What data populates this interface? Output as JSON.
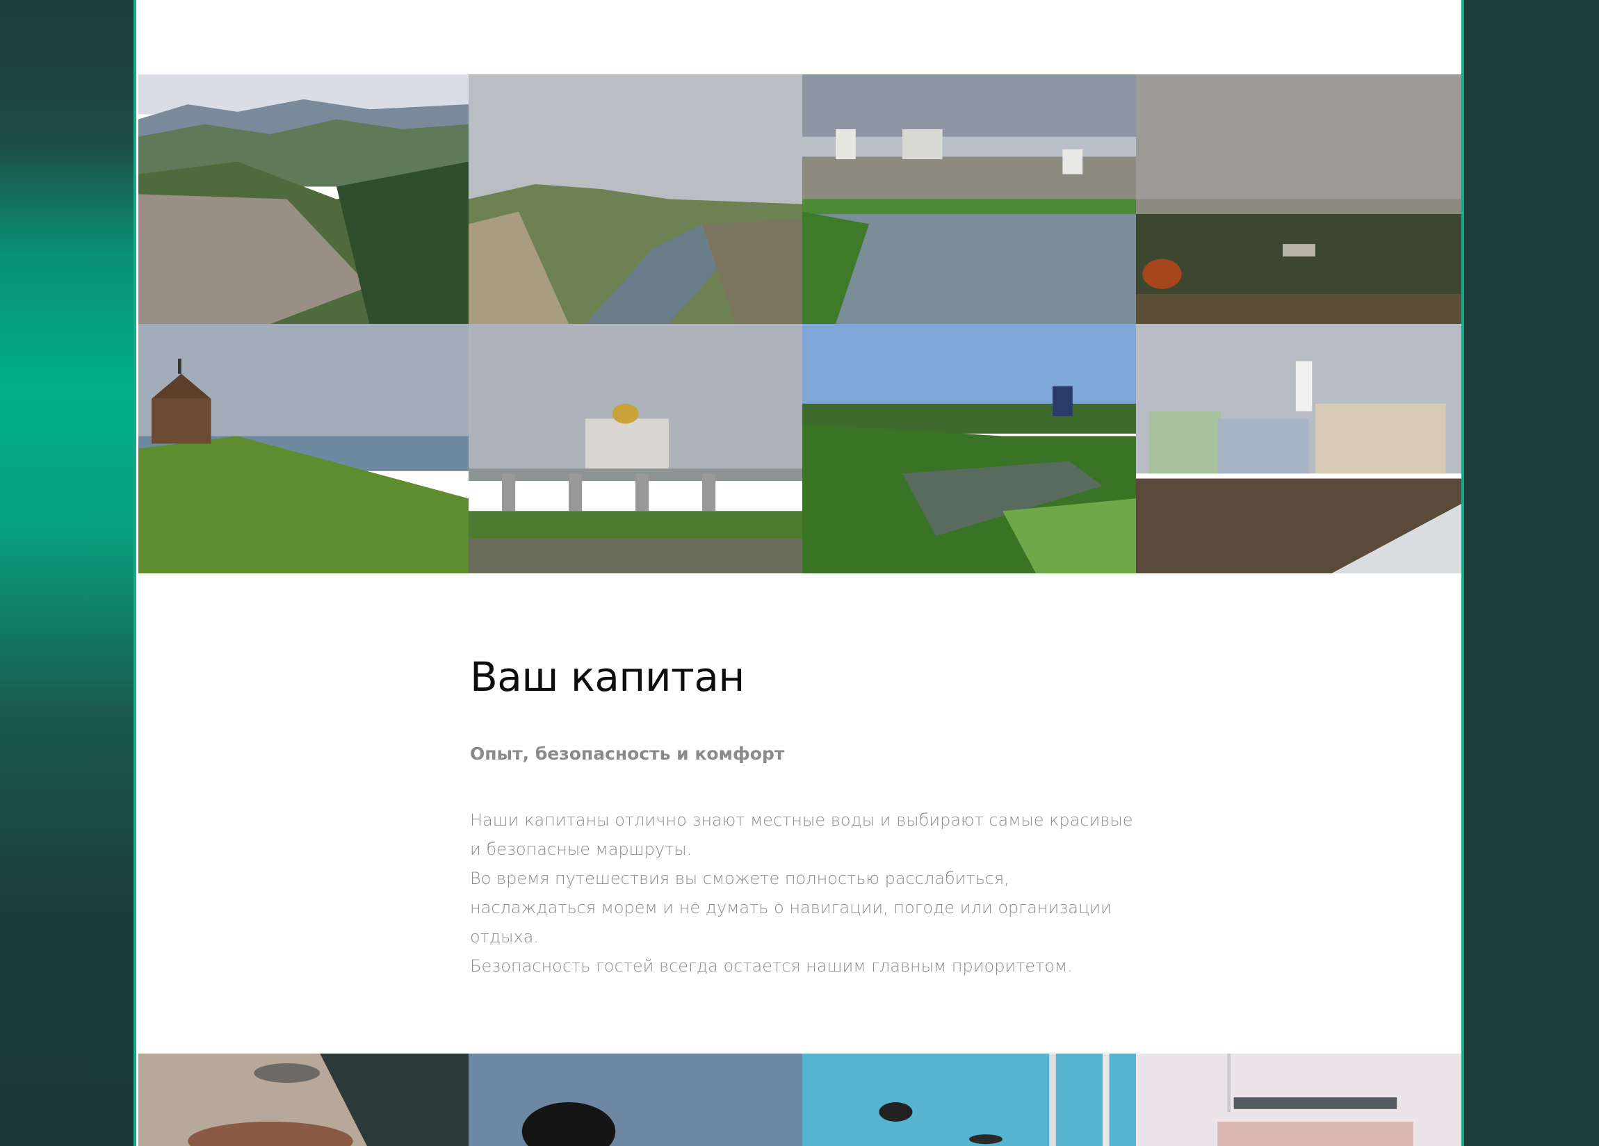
{
  "captain_section": {
    "title": "Ваш капитан",
    "subtitle": "Опыт, безопасность и комфорт",
    "paragraphs": [
      "Наши капитаны отлично знают местные воды и выбирают самые красивые и безопасные маршруты.",
      "Во время путешествия вы сможете полностью расслабиться, наслаждаться морем и не думать о навигации, погоде или организации отдыха.",
      "Безопасность гостей всегда остается нашим главным приоритетом."
    ]
  },
  "colors": {
    "accent": "#16a987",
    "side_dark": "#1e3d3a",
    "side_bright": "#00b085"
  },
  "gallery_top": [
    {
      "name": "mountain-town-photo"
    },
    {
      "name": "river-valley-cliff-photo"
    },
    {
      "name": "monastery-lake-photo"
    },
    {
      "name": "village-overcast-photo"
    },
    {
      "name": "wooden-church-hill-photo"
    },
    {
      "name": "cathedral-bridge-photo"
    },
    {
      "name": "green-river-town-photo"
    },
    {
      "name": "lighthouse-houses-snow-photo"
    }
  ],
  "gallery_bottom": [
    {
      "name": "captain-hands-photo"
    },
    {
      "name": "captain-portrait-photo"
    },
    {
      "name": "sailing-yacht-photo"
    },
    {
      "name": "yacht-deck-photo"
    }
  ]
}
